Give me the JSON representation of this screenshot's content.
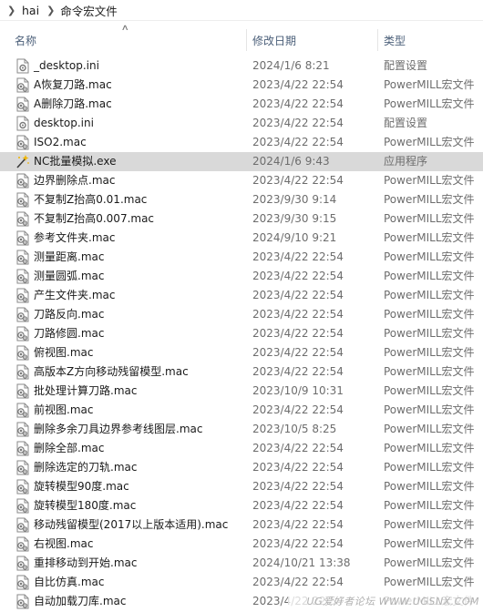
{
  "breadcrumb": {
    "items": [
      "hai",
      "命令宏文件"
    ]
  },
  "columns": {
    "name": "名称",
    "date": "修改日期",
    "type": "类型"
  },
  "files": [
    {
      "name": "_desktop.ini",
      "date": "2024/1/6 8:21",
      "type": "配置设置",
      "icon": "ini-file-icon"
    },
    {
      "name": "A恢复刀路.mac",
      "date": "2023/4/22 22:54",
      "type": "PowerMILL宏文件",
      "icon": "mac-file-icon"
    },
    {
      "name": "A删除刀路.mac",
      "date": "2023/4/22 22:54",
      "type": "PowerMILL宏文件",
      "icon": "mac-file-icon"
    },
    {
      "name": "desktop.ini",
      "date": "2023/4/22 22:54",
      "type": "配置设置",
      "icon": "ini-file-icon"
    },
    {
      "name": "ISO2.mac",
      "date": "2023/4/22 22:54",
      "type": "PowerMILL宏文件",
      "icon": "mac-file-icon"
    },
    {
      "name": "NC批量模拟.exe",
      "date": "2024/1/6 9:43",
      "type": "应用程序",
      "icon": "exe-file-icon",
      "selected": true
    },
    {
      "name": "边界删除点.mac",
      "date": "2023/4/22 22:54",
      "type": "PowerMILL宏文件",
      "icon": "mac-file-icon"
    },
    {
      "name": "不复制Z抬高0.01.mac",
      "date": "2023/9/30 9:14",
      "type": "PowerMILL宏文件",
      "icon": "mac-file-icon"
    },
    {
      "name": "不复制Z抬高0.007.mac",
      "date": "2023/9/30 9:15",
      "type": "PowerMILL宏文件",
      "icon": "mac-file-icon"
    },
    {
      "name": "参考文件夹.mac",
      "date": "2024/9/10 9:21",
      "type": "PowerMILL宏文件",
      "icon": "mac-file-icon"
    },
    {
      "name": "测量距离.mac",
      "date": "2023/4/22 22:54",
      "type": "PowerMILL宏文件",
      "icon": "mac-file-icon"
    },
    {
      "name": "测量圆弧.mac",
      "date": "2023/4/22 22:54",
      "type": "PowerMILL宏文件",
      "icon": "mac-file-icon"
    },
    {
      "name": "产生文件夹.mac",
      "date": "2023/4/22 22:54",
      "type": "PowerMILL宏文件",
      "icon": "mac-file-icon"
    },
    {
      "name": "刀路反向.mac",
      "date": "2023/4/22 22:54",
      "type": "PowerMILL宏文件",
      "icon": "mac-file-icon"
    },
    {
      "name": "刀路修圆.mac",
      "date": "2023/4/22 22:54",
      "type": "PowerMILL宏文件",
      "icon": "mac-file-icon"
    },
    {
      "name": "俯视图.mac",
      "date": "2023/4/22 22:54",
      "type": "PowerMILL宏文件",
      "icon": "mac-file-icon"
    },
    {
      "name": "高版本Z方向移动残留模型.mac",
      "date": "2023/4/22 22:54",
      "type": "PowerMILL宏文件",
      "icon": "mac-file-icon"
    },
    {
      "name": "批处理计算刀路.mac",
      "date": "2023/10/9 10:31",
      "type": "PowerMILL宏文件",
      "icon": "mac-file-icon"
    },
    {
      "name": "前视图.mac",
      "date": "2023/4/22 22:54",
      "type": "PowerMILL宏文件",
      "icon": "mac-file-icon"
    },
    {
      "name": "删除多余刀具边界参考线图层.mac",
      "date": "2023/10/5 8:25",
      "type": "PowerMILL宏文件",
      "icon": "mac-file-icon"
    },
    {
      "name": "删除全部.mac",
      "date": "2023/4/22 22:54",
      "type": "PowerMILL宏文件",
      "icon": "mac-file-icon"
    },
    {
      "name": "删除选定的刀轨.mac",
      "date": "2023/4/22 22:54",
      "type": "PowerMILL宏文件",
      "icon": "mac-file-icon"
    },
    {
      "name": "旋转模型90度.mac",
      "date": "2023/4/22 22:54",
      "type": "PowerMILL宏文件",
      "icon": "mac-file-icon"
    },
    {
      "name": "旋转模型180度.mac",
      "date": "2023/4/22 22:54",
      "type": "PowerMILL宏文件",
      "icon": "mac-file-icon"
    },
    {
      "name": "移动残留模型(2017以上版本适用).mac",
      "date": "2023/4/22 22:54",
      "type": "PowerMILL宏文件",
      "icon": "mac-file-icon"
    },
    {
      "name": "右视图.mac",
      "date": "2023/4/22 22:54",
      "type": "PowerMILL宏文件",
      "icon": "mac-file-icon"
    },
    {
      "name": "重排移动到开始.mac",
      "date": "2024/10/21 13:38",
      "type": "PowerMILL宏文件",
      "icon": "mac-file-icon"
    },
    {
      "name": "自比仿真.mac",
      "date": "2023/4/22 22:54",
      "type": "PowerMILL宏文件",
      "icon": "mac-file-icon"
    },
    {
      "name": "自动加载刀库.mac",
      "date": "2023/4/22 22:54",
      "type": "PowerMILL宏文件",
      "icon": "mac-file-icon"
    }
  ],
  "watermark": "UG爱好者论坛 WWW.UGSNX.COM"
}
